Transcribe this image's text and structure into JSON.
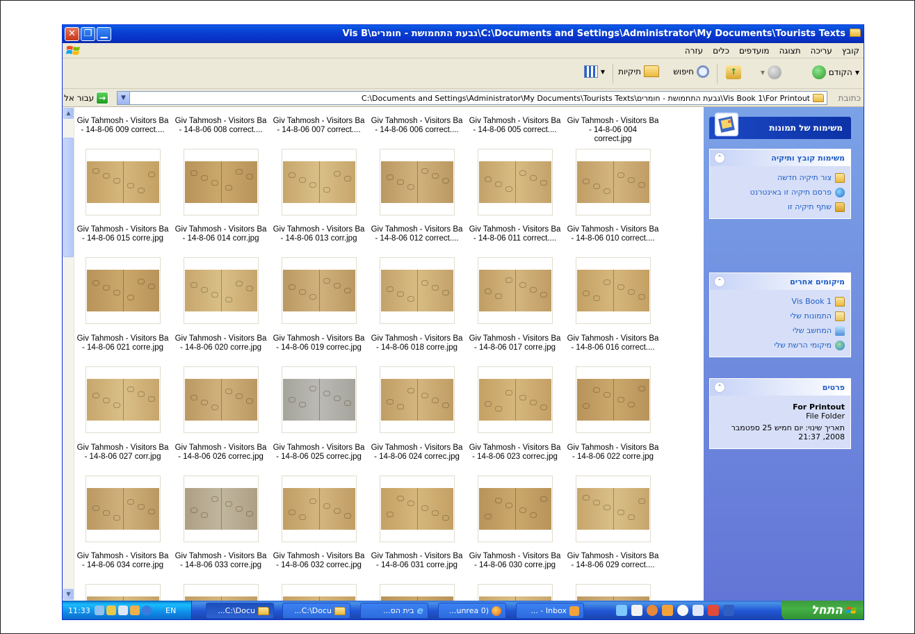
{
  "window": {
    "title": "Vis B\\גבעת התחמושת - חומרים\\C:\\Documents and Settings\\Administrator\\My Documents\\Tourists Texts"
  },
  "menu": [
    "קובץ",
    "עריכה",
    "תצוגה",
    "מועדפים",
    "כלים",
    "עזרה"
  ],
  "toolbar": {
    "back": "הקודם",
    "search": "חיפוש",
    "folders": "תיקיות"
  },
  "address": {
    "label": "כתובת",
    "value": "C:\\Documents and Settings\\Administrator\\My Documents\\Tourists Texts\\גבעת התחמושת - חומרים\\Vis Book 1\\For Printout",
    "go": "עבור אל"
  },
  "captions": {
    "row0": [
      [
        "Giv Tahmosh - Visitors Ba",
        "- 14-8-06 009 correct...."
      ],
      [
        "Giv Tahmosh - Visitors Ba",
        "- 14-8-06 008 correct...."
      ],
      [
        "Giv Tahmosh - Visitors Ba",
        "- 14-8-06 007 correct...."
      ],
      [
        "Giv Tahmosh - Visitors Ba",
        "- 14-8-06 006 correct...."
      ],
      [
        "Giv Tahmosh - Visitors Ba",
        "- 14-8-06 005 correct...."
      ],
      [
        "Giv Tahmosh - Visitors Ba",
        "- 14-8-06 004",
        "correct.jpg"
      ]
    ],
    "row1": [
      [
        "Giv Tahmosh - Visitors Ba",
        "- 14-8-06 015 corre.jpg"
      ],
      [
        "Giv Tahmosh - Visitors Ba",
        "- 14-8-06 014 corr.jpg"
      ],
      [
        "Giv Tahmosh - Visitors Ba",
        "- 14-8-06 013 corr.jpg"
      ],
      [
        "Giv Tahmosh - Visitors Ba",
        "- 14-8-06 012 correct...."
      ],
      [
        "Giv Tahmosh - Visitors Ba",
        "- 14-8-06 011 correct...."
      ],
      [
        "Giv Tahmosh - Visitors Ba",
        "- 14-8-06 010 correct...."
      ]
    ],
    "row2": [
      [
        "Giv Tahmosh - Visitors Ba",
        "- 14-8-06 021 corre.jpg"
      ],
      [
        "Giv Tahmosh - Visitors Ba",
        "- 14-8-06 020 corre.jpg"
      ],
      [
        "Giv Tahmosh - Visitors Ba",
        "- 14-8-06 019 correc.jpg"
      ],
      [
        "Giv Tahmosh - Visitors Ba",
        "- 14-8-06 018 corre.jpg"
      ],
      [
        "Giv Tahmosh - Visitors Ba",
        "- 14-8-06 017 corre.jpg"
      ],
      [
        "Giv Tahmosh - Visitors Ba",
        "- 14-8-06 016 correct...."
      ]
    ],
    "row3": [
      [
        "Giv Tahmosh - Visitors Ba",
        "- 14-8-06 027 corr.jpg"
      ],
      [
        "Giv Tahmosh - Visitors Ba",
        "- 14-8-06 026 correc.jpg"
      ],
      [
        "Giv Tahmosh - Visitors Ba",
        "- 14-8-06 025 correc.jpg"
      ],
      [
        "Giv Tahmosh - Visitors Ba",
        "- 14-8-06 024 correc.jpg"
      ],
      [
        "Giv Tahmosh - Visitors Ba",
        "- 14-8-06 023 correc.jpg"
      ],
      [
        "Giv Tahmosh - Visitors Ba",
        "- 14-8-06 022 corre.jpg"
      ]
    ],
    "row4": [
      [
        "Giv Tahmosh - Visitors Ba",
        "- 14-8-06 034 corre.jpg"
      ],
      [
        "Giv Tahmosh - Visitors Ba",
        "- 14-8-06 033 corre.jpg"
      ],
      [
        "Giv Tahmosh - Visitors Ba",
        "- 14-8-06 032 correc.jpg"
      ],
      [
        "Giv Tahmosh - Visitors Ba",
        "- 14-8-06 031 corre.jpg"
      ],
      [
        "Giv Tahmosh - Visitors Ba",
        "- 14-8-06 030 corre.jpg"
      ],
      [
        "Giv Tahmosh - Visitors Ba",
        "- 14-8-06 029 correct...."
      ]
    ]
  },
  "taskpane": {
    "header": "משימות של תמונות",
    "panels": {
      "file_tasks": {
        "title": "משימות קובץ ותיקיה",
        "items": [
          "צור תיקיה חדשה",
          "פרסם תיקיה זו באינטרנט",
          "שתף תיקיה זו"
        ]
      },
      "other_places": {
        "title": "מיקומים אחרים",
        "items": [
          "Vis Book 1",
          "התמונות שלי",
          "המחשב שלי",
          "מיקומי הרשת שלי"
        ]
      },
      "details": {
        "title": "פרטים",
        "name": "For Printout",
        "type": "File Folder",
        "modified": "תאריך שינוי: יום חמיש 25 ספטמבר 2008, 21:37"
      }
    }
  },
  "taskbar": {
    "clock": "11:33",
    "lang": "EN",
    "start": "התחל",
    "buttons": [
      "...C:\\Docu",
      "...C:\\Docu",
      "...בית הס",
      "...unrea 0)",
      "... - Inbox"
    ]
  }
}
